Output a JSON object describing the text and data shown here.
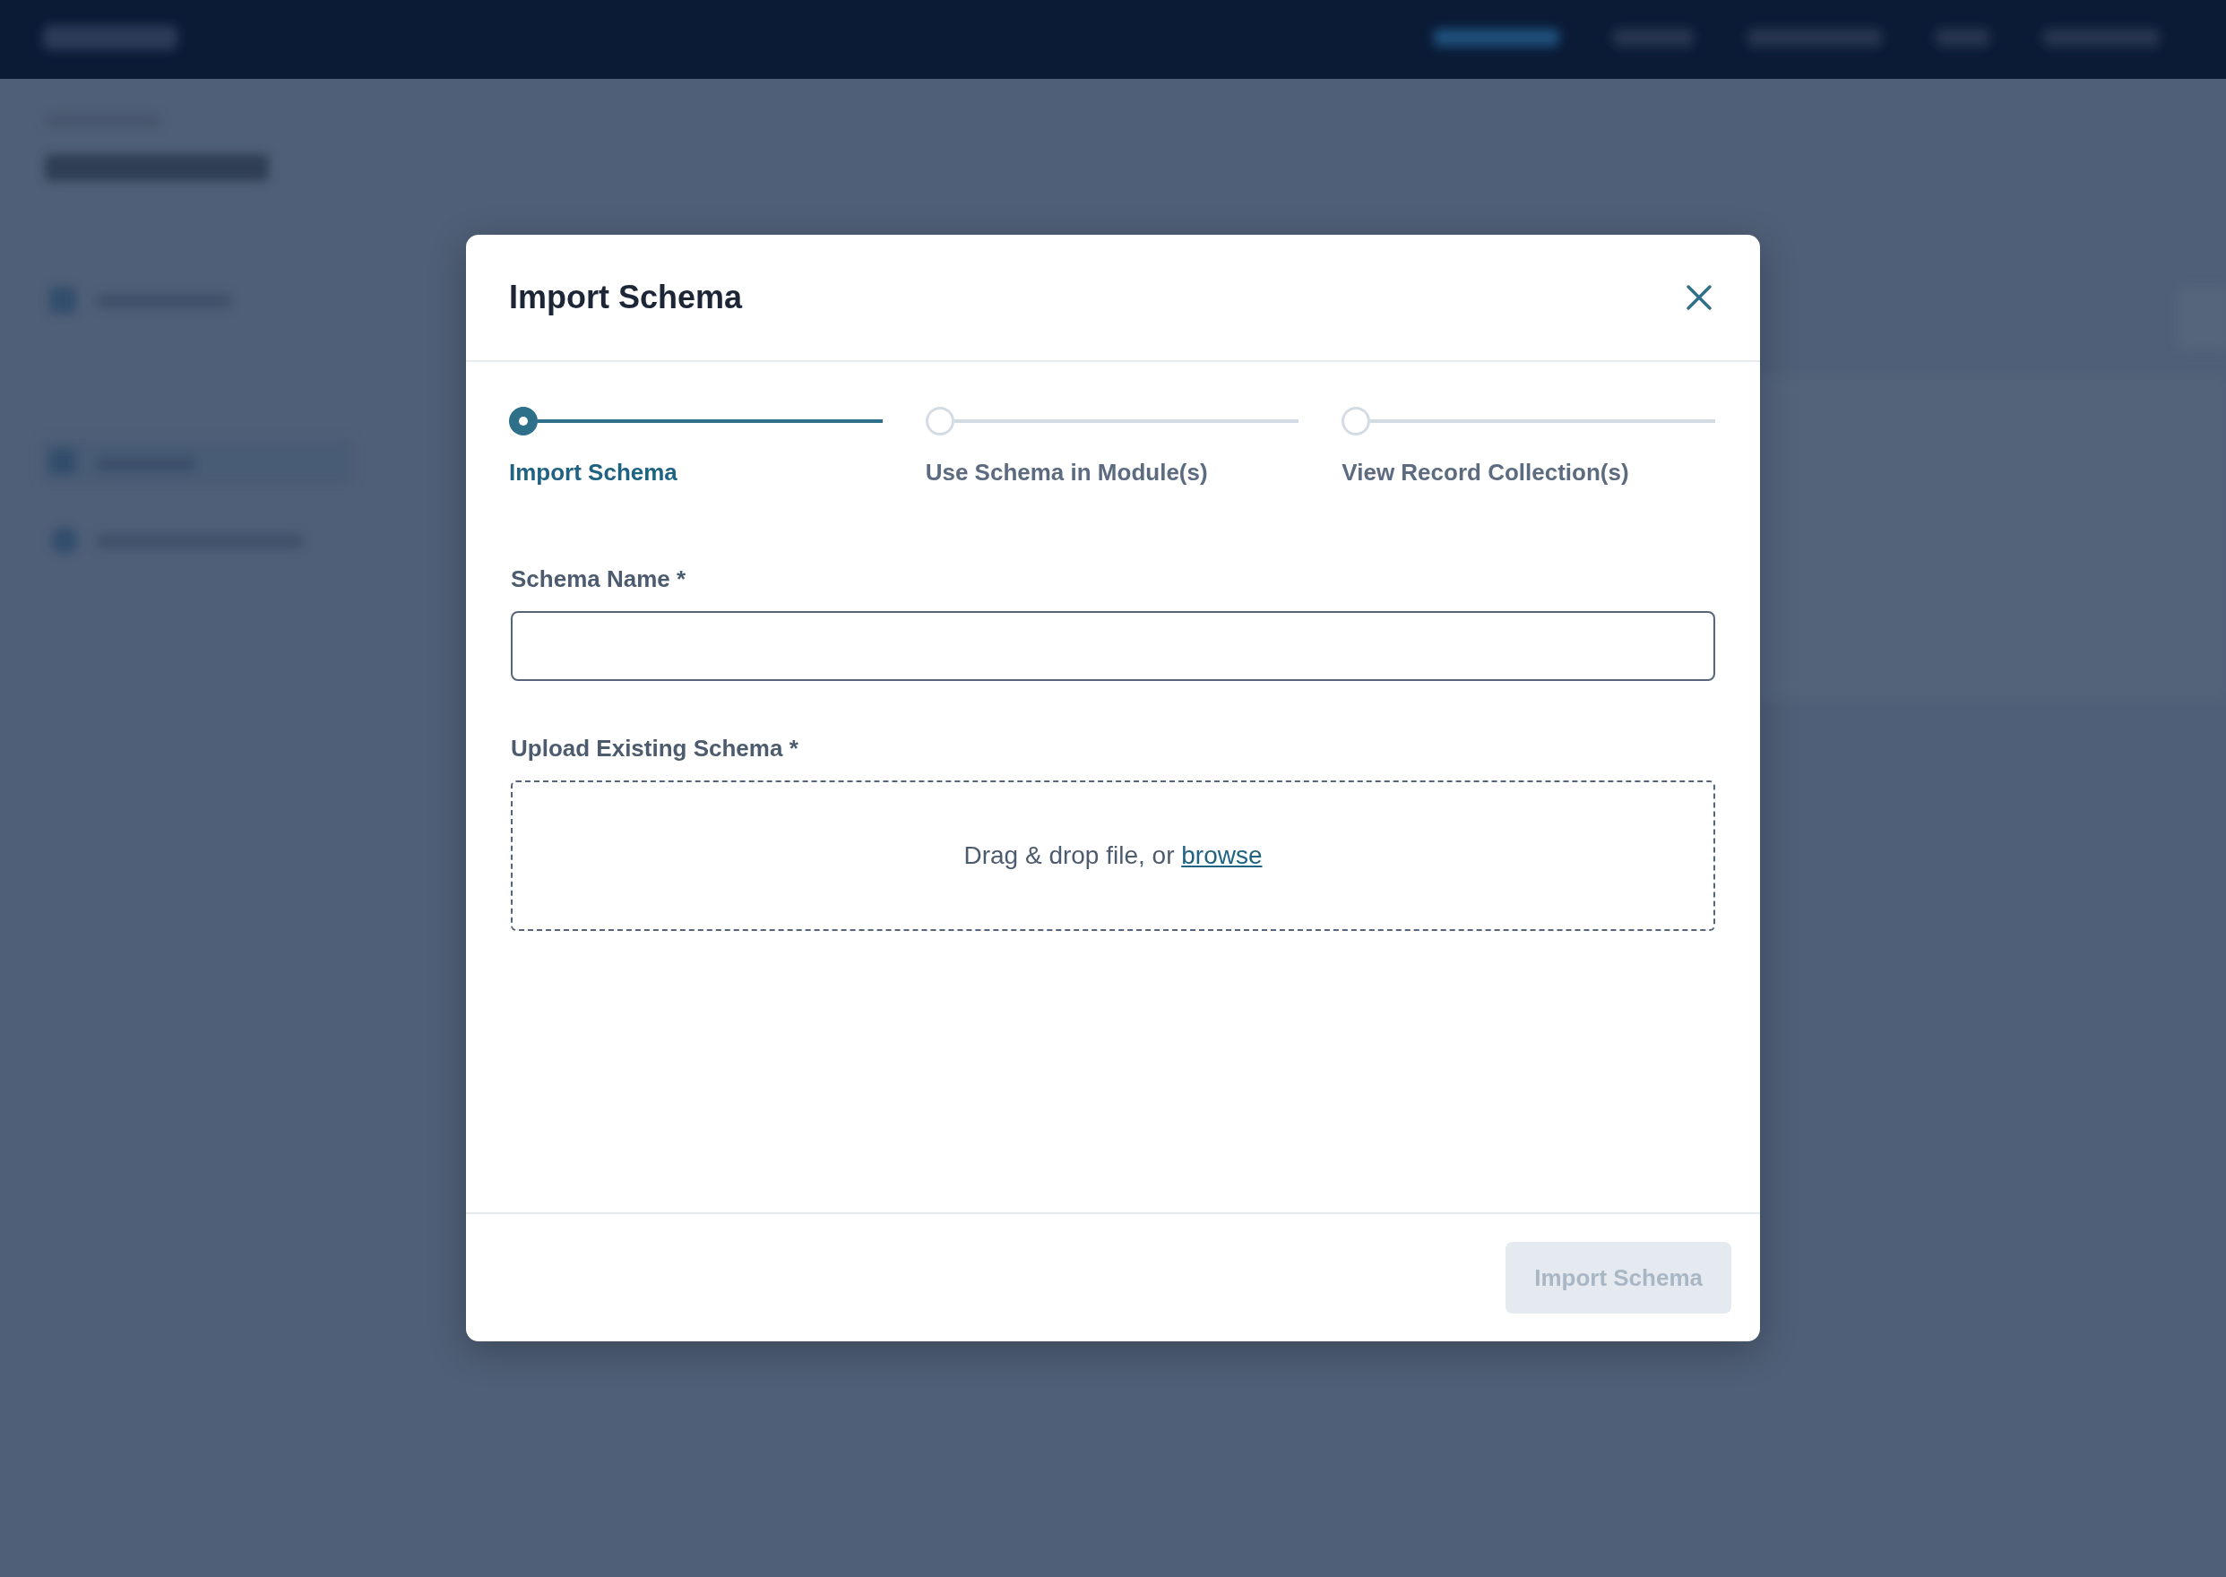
{
  "dialog": {
    "title": "Import Schema",
    "steps": [
      {
        "label": "Import Schema",
        "selected": true
      },
      {
        "label": "Use Schema in Module(s)",
        "selected": false
      },
      {
        "label": "View Record Collection(s)",
        "selected": false
      }
    ],
    "fields": [
      {
        "kind": "text",
        "label": "Schema Name *"
      },
      {
        "kind": "upload",
        "label": "Upload Existing Schema *",
        "prompt": "Drag & drop file, or ",
        "link": "browse"
      }
    ],
    "primary_button": {
      "label": "Import Schema",
      "disabled": true
    }
  }
}
